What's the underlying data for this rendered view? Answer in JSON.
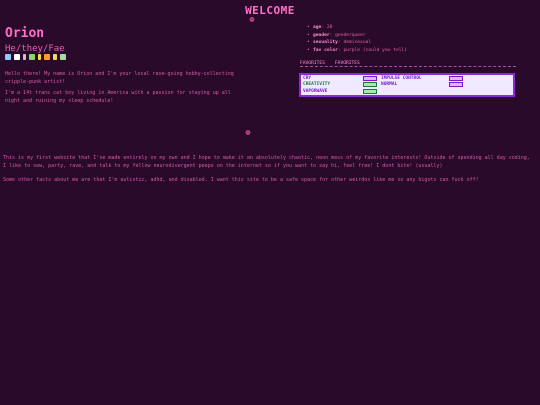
{
  "header": {
    "title": "WELCOME",
    "divider_glyph": "❁"
  },
  "profile": {
    "name": "Orion",
    "pronouns": "He/they/Fae",
    "badges": [
      {
        "icon": "star-badge",
        "color": "#8fc8ff"
      },
      {
        "icon": "sparkle-badge",
        "color": "#ffffff"
      },
      {
        "icon": "feather-badge",
        "color": "#c8c8c8"
      },
      {
        "icon": "leaf-badge",
        "color": "#8ad86a"
      },
      {
        "icon": "flower-badge",
        "color": "#ffd84a"
      },
      {
        "icon": "fire-badge",
        "color": "#ff9a2a"
      },
      {
        "icon": "dot-badge",
        "color": "#ffd84a"
      },
      {
        "icon": "frame-badge",
        "color": "#a8d8a8"
      }
    ],
    "intro_1": "Hello there! My name is Orion and I'm your local rave-going hobby-collecting cripple-punk artist!",
    "intro_2": "I'm a 14t trans cat boy living in America with a passion for staying up all night and ruining my sleep schedule!"
  },
  "facts": [
    {
      "key": "age",
      "value": "20"
    },
    {
      "key": "gender",
      "value": "genderqueer"
    },
    {
      "key": "sexuality",
      "value": "demisexual"
    },
    {
      "key": "fav color",
      "value": "purple (could you tell)"
    }
  ],
  "favorites": {
    "label_a": "FAVORITES",
    "label_b": "FAVORITES"
  },
  "stats": [
    {
      "name": "CRY",
      "level": "IMPULSE CONTROL"
    },
    {
      "name": "CREATIVITY",
      "level": "NORMAL"
    },
    {
      "name": "VAPORWAVE",
      "level": ""
    }
  ],
  "body_text": {
    "para_1": "This is my first website that I've made entirely on my own and I hope to make it an absolutely chaotic, neon mess of my favorite interests! Outside of spending all day coding, I like to sew, party, rave, and talk to my fellow neurodivergent peeps on the internet so if you want to say hi, feel free! I dont bite! (usually)",
    "para_2": "Some other facts about me are that I'm autistic, adhd, and disabled. I want this site to be a safe space for other weirdos like me so any bigots can fuck off!"
  }
}
